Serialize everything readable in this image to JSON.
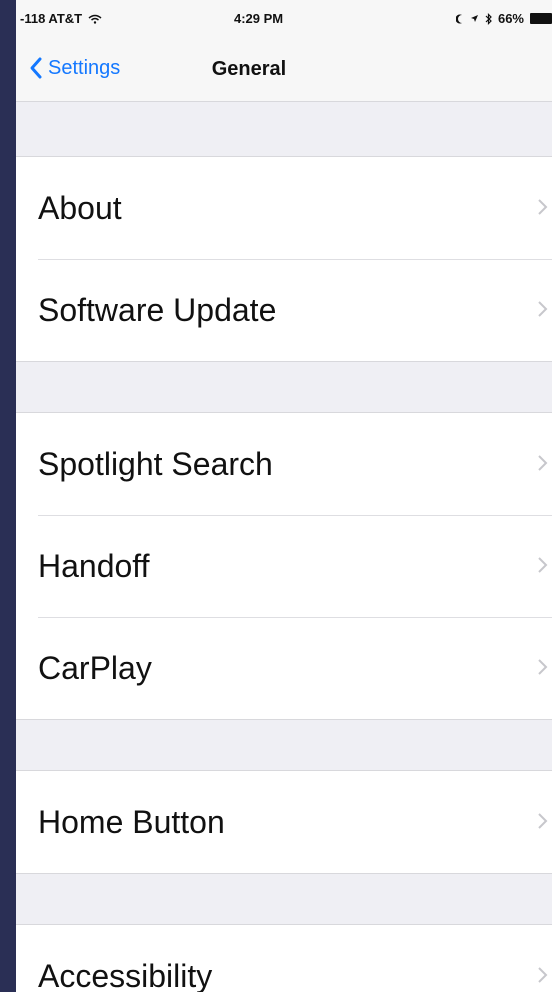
{
  "status_bar": {
    "carrier": "-118 AT&T",
    "wifi_icon": "wifi-icon",
    "time": "4:29 PM",
    "battery_percent": "66%",
    "icons": [
      "moon-icon",
      "location-icon",
      "bluetooth-icon",
      "battery-icon"
    ]
  },
  "nav": {
    "back_label": "Settings",
    "title": "General"
  },
  "groups": [
    {
      "items": [
        {
          "label": "About"
        },
        {
          "label": "Software Update"
        }
      ]
    },
    {
      "items": [
        {
          "label": "Spotlight Search"
        },
        {
          "label": "Handoff"
        },
        {
          "label": "CarPlay"
        }
      ]
    },
    {
      "items": [
        {
          "label": "Home Button"
        }
      ]
    },
    {
      "items": [
        {
          "label": "Accessibility"
        }
      ]
    }
  ],
  "colors": {
    "accent": "#1478ff",
    "background": "#efeff4",
    "cell": "#ffffff",
    "chevron": "#c7c7cc"
  }
}
